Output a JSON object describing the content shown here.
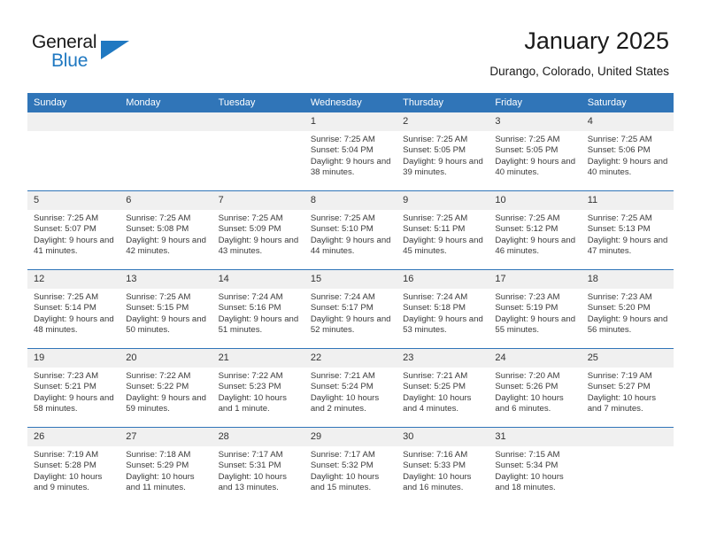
{
  "brand": {
    "word_one": "General",
    "word_two": "Blue",
    "accent_color": "#1f78c1"
  },
  "header": {
    "title": "January 2025",
    "subtitle": "Durango, Colorado, United States"
  },
  "theme": {
    "header_row_bg": "#3075b8",
    "daynum_bg": "#f0f0f0",
    "grid_line": "#3075b8",
    "text": "#3a3a3a"
  },
  "weekdays": [
    "Sunday",
    "Monday",
    "Tuesday",
    "Wednesday",
    "Thursday",
    "Friday",
    "Saturday"
  ],
  "labels": {
    "sunrise_prefix": "Sunrise: ",
    "sunset_prefix": "Sunset: ",
    "daylight_prefix": "Daylight: "
  },
  "weeks": [
    [
      {
        "day": "",
        "empty": true
      },
      {
        "day": "",
        "empty": true
      },
      {
        "day": "",
        "empty": true
      },
      {
        "day": "1",
        "sunrise": "Sunrise: 7:25 AM",
        "sunset": "Sunset: 5:04 PM",
        "daylight": "Daylight: 9 hours and 38 minutes."
      },
      {
        "day": "2",
        "sunrise": "Sunrise: 7:25 AM",
        "sunset": "Sunset: 5:05 PM",
        "daylight": "Daylight: 9 hours and 39 minutes."
      },
      {
        "day": "3",
        "sunrise": "Sunrise: 7:25 AM",
        "sunset": "Sunset: 5:05 PM",
        "daylight": "Daylight: 9 hours and 40 minutes."
      },
      {
        "day": "4",
        "sunrise": "Sunrise: 7:25 AM",
        "sunset": "Sunset: 5:06 PM",
        "daylight": "Daylight: 9 hours and 40 minutes."
      }
    ],
    [
      {
        "day": "5",
        "sunrise": "Sunrise: 7:25 AM",
        "sunset": "Sunset: 5:07 PM",
        "daylight": "Daylight: 9 hours and 41 minutes."
      },
      {
        "day": "6",
        "sunrise": "Sunrise: 7:25 AM",
        "sunset": "Sunset: 5:08 PM",
        "daylight": "Daylight: 9 hours and 42 minutes."
      },
      {
        "day": "7",
        "sunrise": "Sunrise: 7:25 AM",
        "sunset": "Sunset: 5:09 PM",
        "daylight": "Daylight: 9 hours and 43 minutes."
      },
      {
        "day": "8",
        "sunrise": "Sunrise: 7:25 AM",
        "sunset": "Sunset: 5:10 PM",
        "daylight": "Daylight: 9 hours and 44 minutes."
      },
      {
        "day": "9",
        "sunrise": "Sunrise: 7:25 AM",
        "sunset": "Sunset: 5:11 PM",
        "daylight": "Daylight: 9 hours and 45 minutes."
      },
      {
        "day": "10",
        "sunrise": "Sunrise: 7:25 AM",
        "sunset": "Sunset: 5:12 PM",
        "daylight": "Daylight: 9 hours and 46 minutes."
      },
      {
        "day": "11",
        "sunrise": "Sunrise: 7:25 AM",
        "sunset": "Sunset: 5:13 PM",
        "daylight": "Daylight: 9 hours and 47 minutes."
      }
    ],
    [
      {
        "day": "12",
        "sunrise": "Sunrise: 7:25 AM",
        "sunset": "Sunset: 5:14 PM",
        "daylight": "Daylight: 9 hours and 48 minutes."
      },
      {
        "day": "13",
        "sunrise": "Sunrise: 7:25 AM",
        "sunset": "Sunset: 5:15 PM",
        "daylight": "Daylight: 9 hours and 50 minutes."
      },
      {
        "day": "14",
        "sunrise": "Sunrise: 7:24 AM",
        "sunset": "Sunset: 5:16 PM",
        "daylight": "Daylight: 9 hours and 51 minutes."
      },
      {
        "day": "15",
        "sunrise": "Sunrise: 7:24 AM",
        "sunset": "Sunset: 5:17 PM",
        "daylight": "Daylight: 9 hours and 52 minutes."
      },
      {
        "day": "16",
        "sunrise": "Sunrise: 7:24 AM",
        "sunset": "Sunset: 5:18 PM",
        "daylight": "Daylight: 9 hours and 53 minutes."
      },
      {
        "day": "17",
        "sunrise": "Sunrise: 7:23 AM",
        "sunset": "Sunset: 5:19 PM",
        "daylight": "Daylight: 9 hours and 55 minutes."
      },
      {
        "day": "18",
        "sunrise": "Sunrise: 7:23 AM",
        "sunset": "Sunset: 5:20 PM",
        "daylight": "Daylight: 9 hours and 56 minutes."
      }
    ],
    [
      {
        "day": "19",
        "sunrise": "Sunrise: 7:23 AM",
        "sunset": "Sunset: 5:21 PM",
        "daylight": "Daylight: 9 hours and 58 minutes."
      },
      {
        "day": "20",
        "sunrise": "Sunrise: 7:22 AM",
        "sunset": "Sunset: 5:22 PM",
        "daylight": "Daylight: 9 hours and 59 minutes."
      },
      {
        "day": "21",
        "sunrise": "Sunrise: 7:22 AM",
        "sunset": "Sunset: 5:23 PM",
        "daylight": "Daylight: 10 hours and 1 minute."
      },
      {
        "day": "22",
        "sunrise": "Sunrise: 7:21 AM",
        "sunset": "Sunset: 5:24 PM",
        "daylight": "Daylight: 10 hours and 2 minutes."
      },
      {
        "day": "23",
        "sunrise": "Sunrise: 7:21 AM",
        "sunset": "Sunset: 5:25 PM",
        "daylight": "Daylight: 10 hours and 4 minutes."
      },
      {
        "day": "24",
        "sunrise": "Sunrise: 7:20 AM",
        "sunset": "Sunset: 5:26 PM",
        "daylight": "Daylight: 10 hours and 6 minutes."
      },
      {
        "day": "25",
        "sunrise": "Sunrise: 7:19 AM",
        "sunset": "Sunset: 5:27 PM",
        "daylight": "Daylight: 10 hours and 7 minutes."
      }
    ],
    [
      {
        "day": "26",
        "sunrise": "Sunrise: 7:19 AM",
        "sunset": "Sunset: 5:28 PM",
        "daylight": "Daylight: 10 hours and 9 minutes."
      },
      {
        "day": "27",
        "sunrise": "Sunrise: 7:18 AM",
        "sunset": "Sunset: 5:29 PM",
        "daylight": "Daylight: 10 hours and 11 minutes."
      },
      {
        "day": "28",
        "sunrise": "Sunrise: 7:17 AM",
        "sunset": "Sunset: 5:31 PM",
        "daylight": "Daylight: 10 hours and 13 minutes."
      },
      {
        "day": "29",
        "sunrise": "Sunrise: 7:17 AM",
        "sunset": "Sunset: 5:32 PM",
        "daylight": "Daylight: 10 hours and 15 minutes."
      },
      {
        "day": "30",
        "sunrise": "Sunrise: 7:16 AM",
        "sunset": "Sunset: 5:33 PM",
        "daylight": "Daylight: 10 hours and 16 minutes."
      },
      {
        "day": "31",
        "sunrise": "Sunrise: 7:15 AM",
        "sunset": "Sunset: 5:34 PM",
        "daylight": "Daylight: 10 hours and 18 minutes."
      },
      {
        "day": "",
        "empty": true
      }
    ]
  ]
}
